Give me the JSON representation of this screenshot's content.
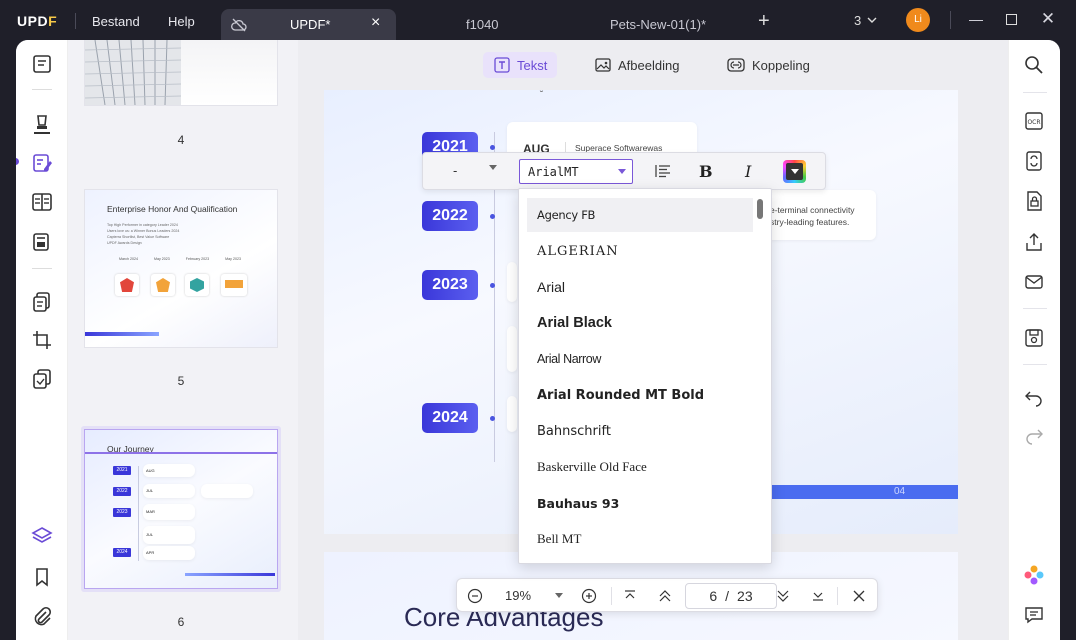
{
  "app": {
    "logo_a": "UPD",
    "logo_b": "F",
    "menu": [
      "Bestand",
      "Help"
    ],
    "tabs": [
      "UPDF*",
      "f1040",
      "Pets-New-01(1)*"
    ],
    "tab_count": "3",
    "avatar": "Li"
  },
  "toolbar": {
    "text": "Tekst",
    "image": "Afbeelding",
    "link": "Koppeling"
  },
  "thumbnails": [
    {
      "num": "4"
    },
    {
      "num": "5",
      "title": "Enterprise Honor And Qualification",
      "bullets": [
        "Top High Performer in category Leader 2024",
        "Users love us: a Winner Bonus Leaders 2024",
        "Capterra Shortlist, Best Value Software",
        "UPDF Awards Design"
      ],
      "years": [
        "March 2024",
        "May 2023",
        "February 2023",
        "May 2023"
      ]
    },
    {
      "num": "6",
      "title": "Our Journey",
      "years": [
        "2021",
        "2022",
        "2023",
        "2024"
      ],
      "months": [
        "AUG",
        "JUL",
        "MAR",
        "JUL",
        "APR"
      ]
    }
  ],
  "page": {
    "years": [
      "2021",
      "2022",
      "2023",
      "2024"
    ],
    "aug_label": "AUG",
    "aug_text": "Superace Softwarewas founded.",
    "card2_line1": "e-terminal connectivity",
    "card2_line2": "stry-leading features.",
    "page_number": "04",
    "next_title": "Core Advantages"
  },
  "format_bar": {
    "size_value": "-",
    "font_value": "ArialMT",
    "bold": "B",
    "italic": "I"
  },
  "font_list": [
    "Agency FB",
    "ALGERIAN",
    "Arial",
    "Arial Black",
    "Arial Narrow",
    "Arial Rounded MT Bold",
    "Bahnschrift",
    "Baskerville Old Face",
    "Bauhaus 93",
    "Bell MT"
  ],
  "nav": {
    "zoom": "19%",
    "current_page": "6",
    "separator": "/",
    "total_pages": "23"
  },
  "colors": {
    "accent": "#6a4bd6",
    "year_badge": "#3a37d9",
    "titlebar": "#1f1f29"
  }
}
